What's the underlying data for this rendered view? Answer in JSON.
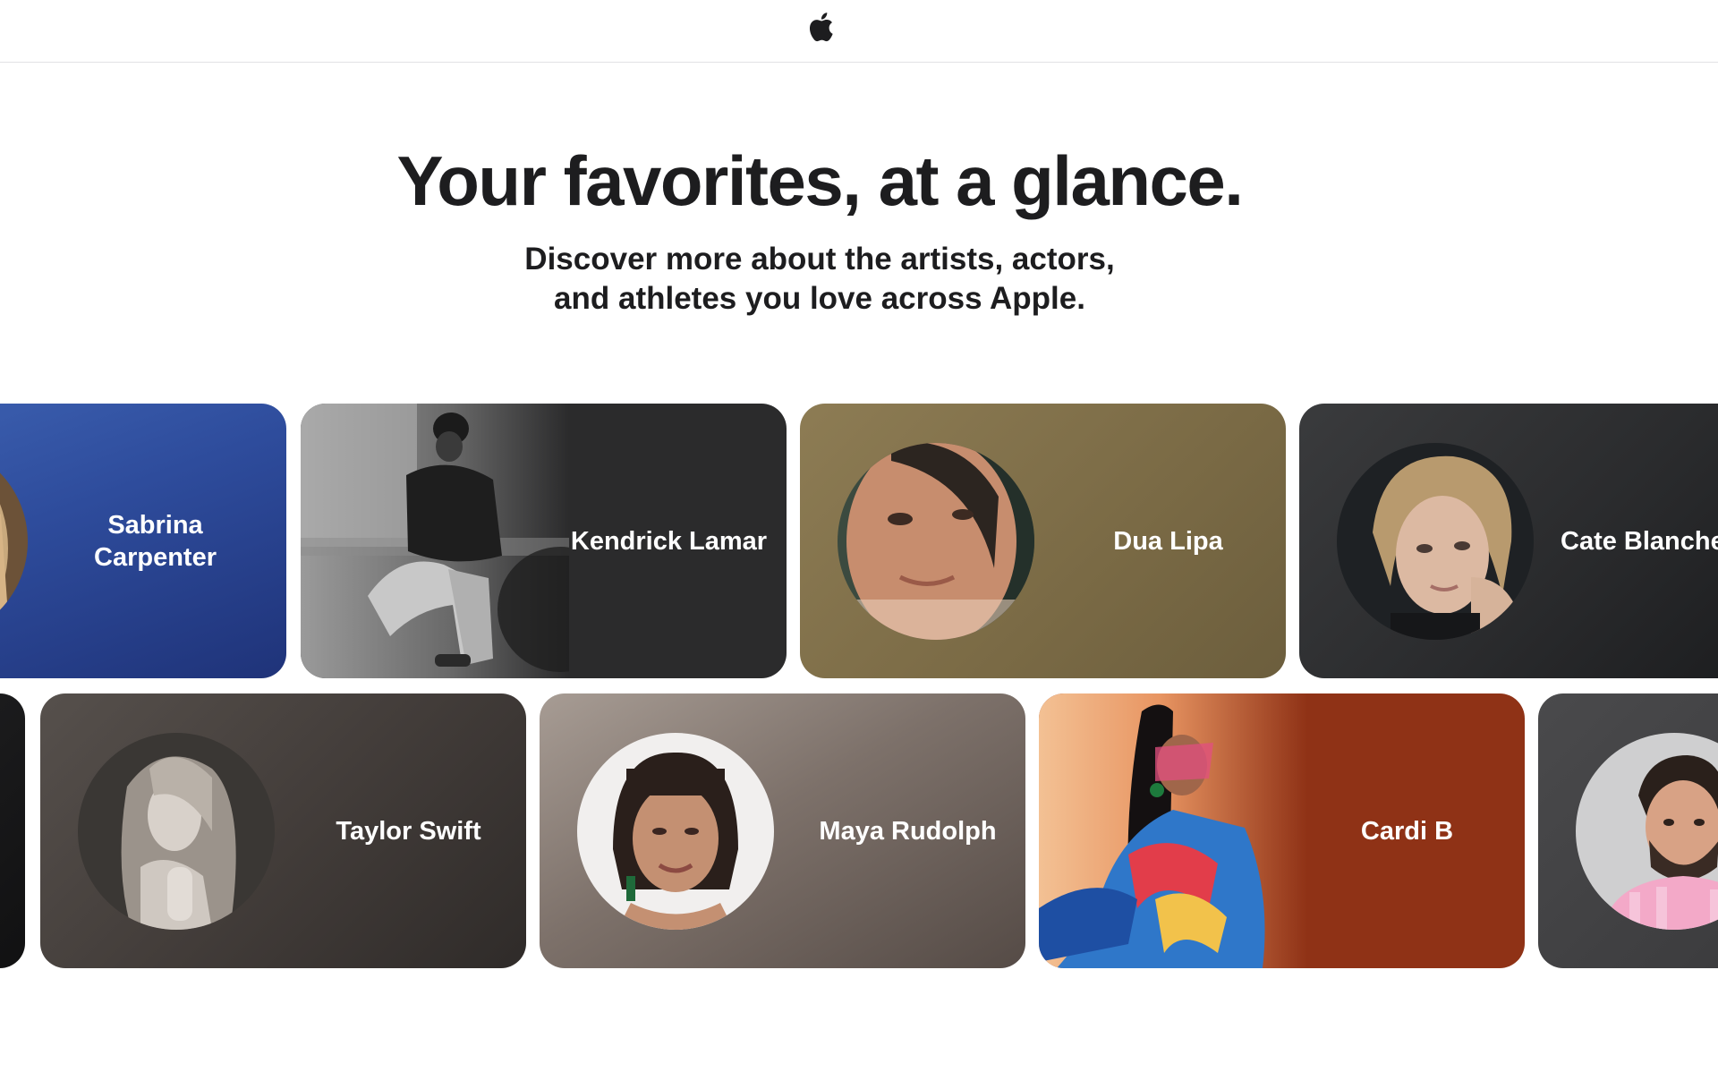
{
  "nav": {
    "logo": "apple-logo-icon"
  },
  "hero": {
    "title": "Your favorites, at a glance.",
    "subtitle_line1": "Discover more about the artists, actors,",
    "subtitle_line2": "and athletes you love across Apple."
  },
  "rows": {
    "top": [
      {
        "name_line1": "Sabrina",
        "name_line2": "Carpenter",
        "bg": "#2f4fa0"
      },
      {
        "name": "Kendrick Lamar",
        "bg": "#2b2b2c"
      },
      {
        "name": "Dua Lipa",
        "bg": "#7f6f49"
      },
      {
        "name": "Cate Blanche",
        "bg": "#2a2b2d"
      }
    ],
    "bottom": [
      {
        "name": "",
        "bg": "#1e1e20"
      },
      {
        "name": "Taylor Swift",
        "bg": "#443e3b"
      },
      {
        "name": "Maya Rudolph",
        "bg": "#6f655f"
      },
      {
        "name": "Cardi B",
        "bg": "#8f3216"
      },
      {
        "name": "",
        "bg": "#3c3c3e"
      }
    ]
  }
}
